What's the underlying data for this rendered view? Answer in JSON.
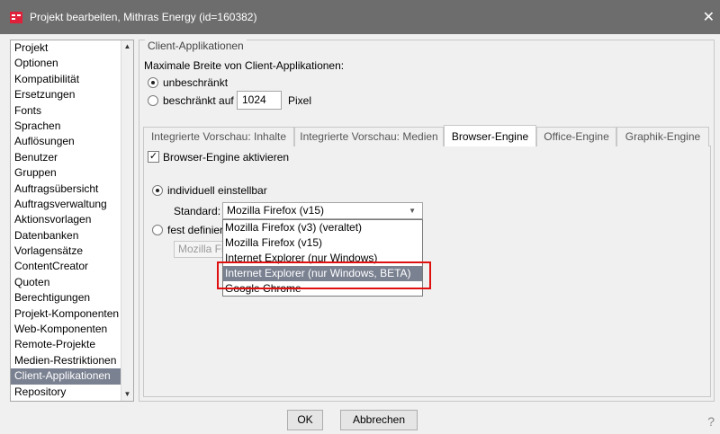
{
  "window": {
    "title": "Projekt bearbeiten, Mithras Energy (id=160382)",
    "close": "✕"
  },
  "nav": {
    "items": [
      "Projekt",
      "Optionen",
      "Kompatibilität",
      "Ersetzungen",
      "Fonts",
      "Sprachen",
      "Auflösungen",
      "Benutzer",
      "Gruppen",
      "Auftragsübersicht",
      "Auftragsverwaltung",
      "Aktionsvorlagen",
      "Datenbanken",
      "Vorlagensätze",
      "ContentCreator",
      "Quoten",
      "Berechtigungen",
      "Projekt-Komponenten",
      "Web-Komponenten",
      "Remote-Projekte",
      "Medien-Restriktionen",
      "Client-Applikationen",
      "Repository"
    ],
    "selected_index": 21
  },
  "section": {
    "legend": "Client-Applikationen",
    "max_width_label": "Maximale Breite von Client-Applikationen:",
    "unlimited": "unbeschränkt",
    "limited": "beschränkt auf",
    "width_value": "1024",
    "unit": "Pixel"
  },
  "tabs": [
    {
      "label": "Integrierte Vorschau: Inhalte"
    },
    {
      "label": "Integrierte Vorschau: Medien"
    },
    {
      "label": "Browser-Engine"
    },
    {
      "label": "Office-Engine"
    },
    {
      "label": "Graphik-Engine"
    }
  ],
  "active_tab": "Browser-Engine",
  "engine": {
    "activate": "Browser-Engine aktivieren",
    "individual": "individuell einstellbar",
    "standard_label": "Standard:",
    "standard_value": "Mozilla Firefox (v15)",
    "fixed": "fest definier",
    "fixed_value": "Mozilla Fir",
    "options": [
      "Mozilla Firefox (v3) (veraltet)",
      "Mozilla Firefox (v15)",
      "Internet Explorer (nur Windows)",
      "Internet Explorer (nur Windows, BETA)",
      "Google Chrome"
    ],
    "highlighted_option": "Internet Explorer (nur Windows, BETA)"
  },
  "buttons": {
    "ok": "OK",
    "cancel": "Abbrechen",
    "help": "?"
  },
  "colors": {
    "titlebar": "#6d6d6d",
    "selection": "#7a8191",
    "annotation": "#e01010"
  }
}
